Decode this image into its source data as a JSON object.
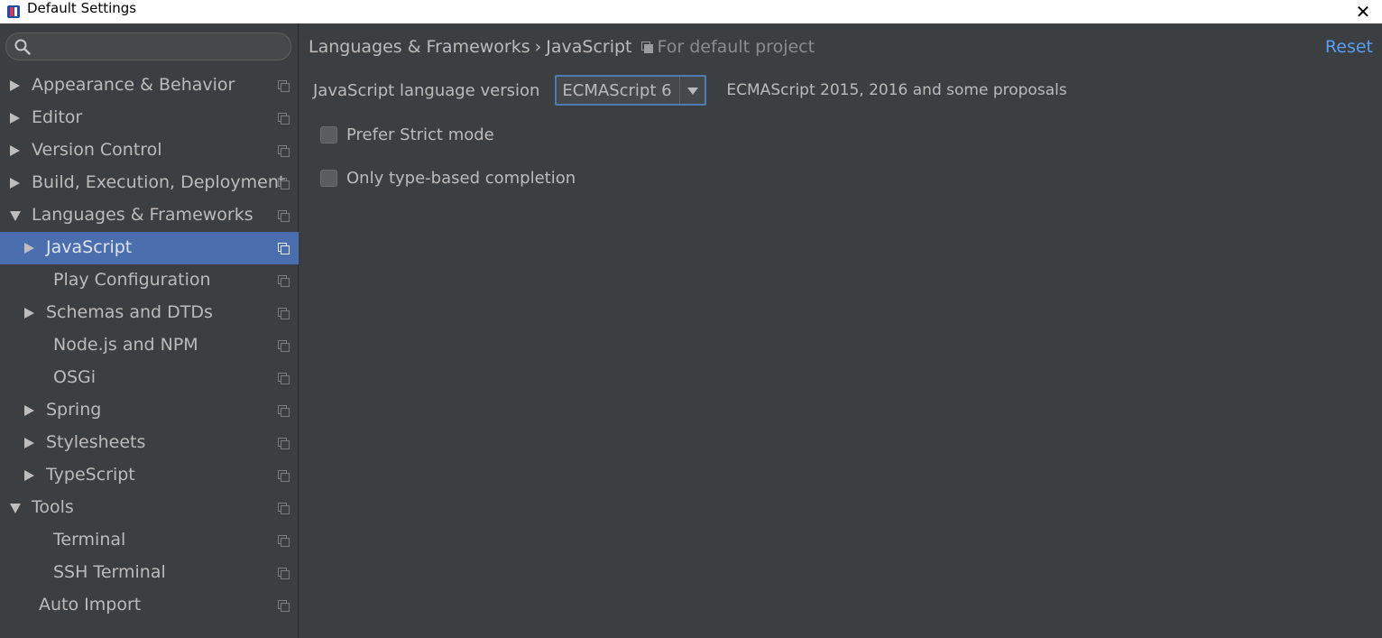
{
  "window": {
    "title": "Default Settings"
  },
  "sidebar": {
    "search": {
      "placeholder": "",
      "value": ""
    },
    "items": [
      {
        "label": "Appearance & Behavior",
        "level": 0,
        "arrow": "right",
        "selected": false
      },
      {
        "label": "Editor",
        "level": 0,
        "arrow": "right",
        "selected": false
      },
      {
        "label": "Version Control",
        "level": 0,
        "arrow": "right",
        "selected": false
      },
      {
        "label": "Build, Execution, Deployment",
        "level": 0,
        "arrow": "right",
        "selected": false
      },
      {
        "label": "Languages & Frameworks",
        "level": 0,
        "arrow": "down",
        "selected": false
      },
      {
        "label": "JavaScript",
        "level": 1,
        "arrow": "right",
        "selected": true
      },
      {
        "label": "Play Configuration",
        "level": 1,
        "arrow": "none",
        "selected": false
      },
      {
        "label": "Schemas and DTDs",
        "level": 1,
        "arrow": "right",
        "selected": false
      },
      {
        "label": "Node.js and NPM",
        "level": 1,
        "arrow": "none",
        "selected": false
      },
      {
        "label": "OSGi",
        "level": 1,
        "arrow": "none",
        "selected": false
      },
      {
        "label": "Spring",
        "level": 1,
        "arrow": "right",
        "selected": false
      },
      {
        "label": "Stylesheets",
        "level": 1,
        "arrow": "right",
        "selected": false
      },
      {
        "label": "TypeScript",
        "level": 1,
        "arrow": "right",
        "selected": false
      },
      {
        "label": "Tools",
        "level": 0,
        "arrow": "down",
        "selected": false
      },
      {
        "label": "Terminal",
        "level": 1,
        "arrow": "none",
        "selected": false
      },
      {
        "label": "SSH Terminal",
        "level": 1,
        "arrow": "none",
        "selected": false
      },
      {
        "label": "Auto Import",
        "level": 0,
        "arrow": "none",
        "selected": false
      }
    ]
  },
  "content": {
    "breadcrumb": {
      "parent": "Languages & Frameworks",
      "separator": "›",
      "current": "JavaScript",
      "scope": "For default project"
    },
    "reset_label": "Reset",
    "language_version": {
      "label": "JavaScript language version",
      "selected": "ECMAScript 6",
      "description": "ECMAScript 2015, 2016 and some proposals"
    },
    "checkboxes": [
      {
        "label": "Prefer Strict mode",
        "checked": false
      },
      {
        "label": "Only type-based completion",
        "checked": false
      }
    ]
  },
  "colors": {
    "background": "#3c3f41",
    "selection": "#4b6eaf",
    "link": "#589df6",
    "focus_border": "#4e7ab5",
    "text": "#bbbbbb"
  }
}
